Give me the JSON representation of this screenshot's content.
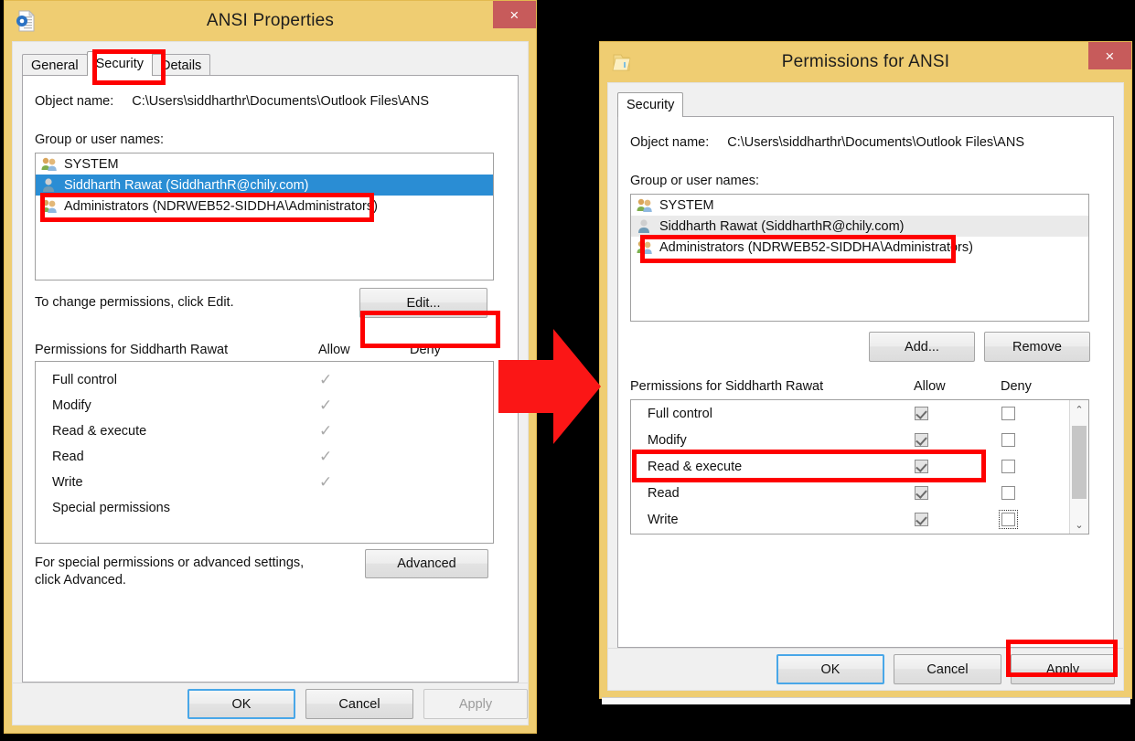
{
  "left_dialog": {
    "title": "ANSI Properties",
    "icon": "outlook-data-file-icon",
    "close_label": "×",
    "tabs": [
      {
        "label": "General",
        "active": false
      },
      {
        "label": "Security",
        "active": true
      },
      {
        "label": "Details",
        "active": false
      }
    ],
    "object_name_label": "Object name:",
    "object_name_value": "C:\\Users\\siddharthr\\Documents\\Outlook Files\\ANS",
    "group_label": "Group or user names:",
    "users": [
      {
        "name": "SYSTEM",
        "icon": "group-icon",
        "selected": false
      },
      {
        "name": "Siddharth Rawat (SiddharthR@chily.com)",
        "icon": "user-icon",
        "selected": true
      },
      {
        "name": "Administrators (NDRWEB52-SIDDHA\\Administrators)",
        "icon": "group-icon",
        "selected": false
      }
    ],
    "change_hint": "To change permissions, click Edit.",
    "edit_button": "Edit...",
    "permissions_header": "Permissions for Siddharth Rawat",
    "allow_header": "Allow",
    "deny_header": "Deny",
    "permissions": [
      {
        "name": "Full control",
        "allow": true,
        "deny": false
      },
      {
        "name": "Modify",
        "allow": true,
        "deny": false
      },
      {
        "name": "Read & execute",
        "allow": true,
        "deny": false
      },
      {
        "name": "Read",
        "allow": true,
        "deny": false
      },
      {
        "name": "Write",
        "allow": true,
        "deny": false
      },
      {
        "name": "Special permissions",
        "allow": false,
        "deny": false
      }
    ],
    "advanced_hint_line1": "For special permissions or advanced settings,",
    "advanced_hint_line2": "click Advanced.",
    "advanced_button": "Advanced",
    "ok_button": "OK",
    "cancel_button": "Cancel",
    "apply_button": "Apply"
  },
  "right_dialog": {
    "title": "Permissions for ANSI",
    "icon": "folder-icon",
    "close_label": "×",
    "tabs": [
      {
        "label": "Security",
        "active": true
      }
    ],
    "object_name_label": "Object name:",
    "object_name_value": "C:\\Users\\siddharthr\\Documents\\Outlook Files\\ANS",
    "group_label": "Group or user names:",
    "users": [
      {
        "name": "SYSTEM",
        "icon": "group-icon",
        "selected": false
      },
      {
        "name": "Siddharth Rawat (SiddharthR@chily.com)",
        "icon": "user-icon",
        "selected": true
      },
      {
        "name": "Administrators (NDRWEB52-SIDDHA\\Administrators)",
        "icon": "group-icon",
        "selected": false
      }
    ],
    "add_button": "Add...",
    "remove_button": "Remove",
    "permissions_header": "Permissions for Siddharth Rawat",
    "allow_header": "Allow",
    "deny_header": "Deny",
    "permissions": [
      {
        "name": "Full control",
        "allow": true,
        "deny": false,
        "deny_focus": false
      },
      {
        "name": "Modify",
        "allow": true,
        "deny": false,
        "deny_focus": false
      },
      {
        "name": "Read & execute",
        "allow": true,
        "deny": false,
        "deny_focus": false
      },
      {
        "name": "Read",
        "allow": true,
        "deny": false,
        "deny_focus": false
      },
      {
        "name": "Write",
        "allow": true,
        "deny": false,
        "deny_focus": true
      }
    ],
    "scroll_up_glyph": "⌃",
    "scroll_down_glyph": "⌄",
    "ok_button": "OK",
    "cancel_button": "Cancel",
    "apply_button": "Apply"
  },
  "annotations": {
    "arrow_name": "red-right-arrow",
    "colors": {
      "highlight": "#fe0000",
      "title_bar": "#efcd72",
      "close_button": "#c75b5b",
      "selection_blue": "#2a8dd4"
    }
  }
}
